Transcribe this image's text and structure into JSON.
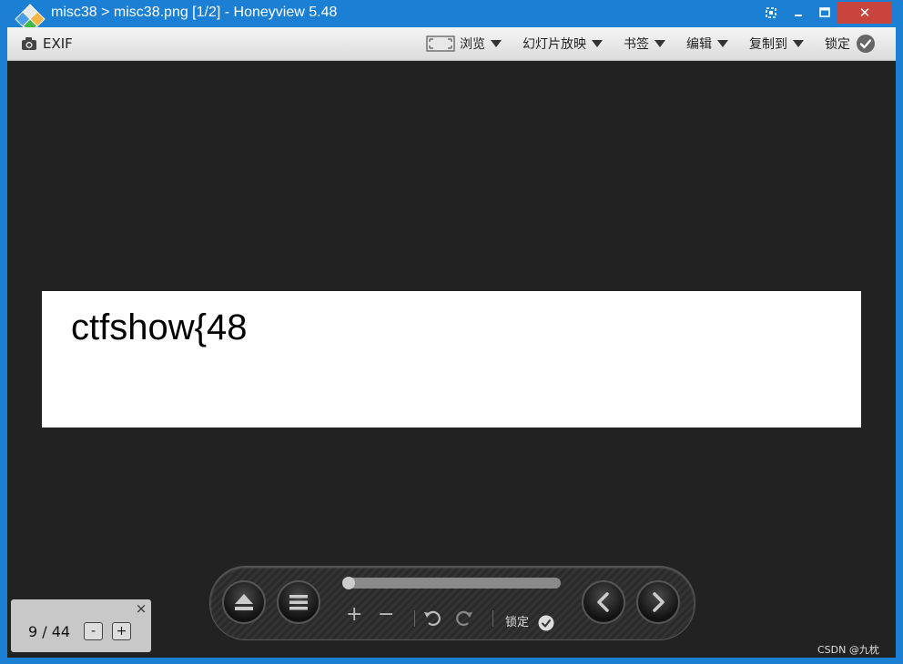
{
  "window": {
    "title": "misc38 > misc38.png [1/2] - Honeyview 5.48",
    "restore_icon": "restore-icon",
    "minimize_icon": "minimize-icon",
    "maximize_icon": "maximize-icon",
    "close_label": "✕"
  },
  "toolbar": {
    "exif_label": "EXIF",
    "browse_label": "浏览",
    "slideshow_label": "幻灯片放映",
    "bookmark_label": "书签",
    "edit_label": "编辑",
    "copy_to_label": "复制到",
    "lock_label": "锁定"
  },
  "image": {
    "text": "ctfshow{48"
  },
  "panel": {
    "counter": "9 / 44",
    "minus_label": "-",
    "plus_label": "+",
    "close_label": "×"
  },
  "player": {
    "progress": 0.0,
    "zoom_in_label": "+",
    "zoom_out_label": "−",
    "lock_label": "锁定"
  },
  "watermark": "CSDN @九枕"
}
